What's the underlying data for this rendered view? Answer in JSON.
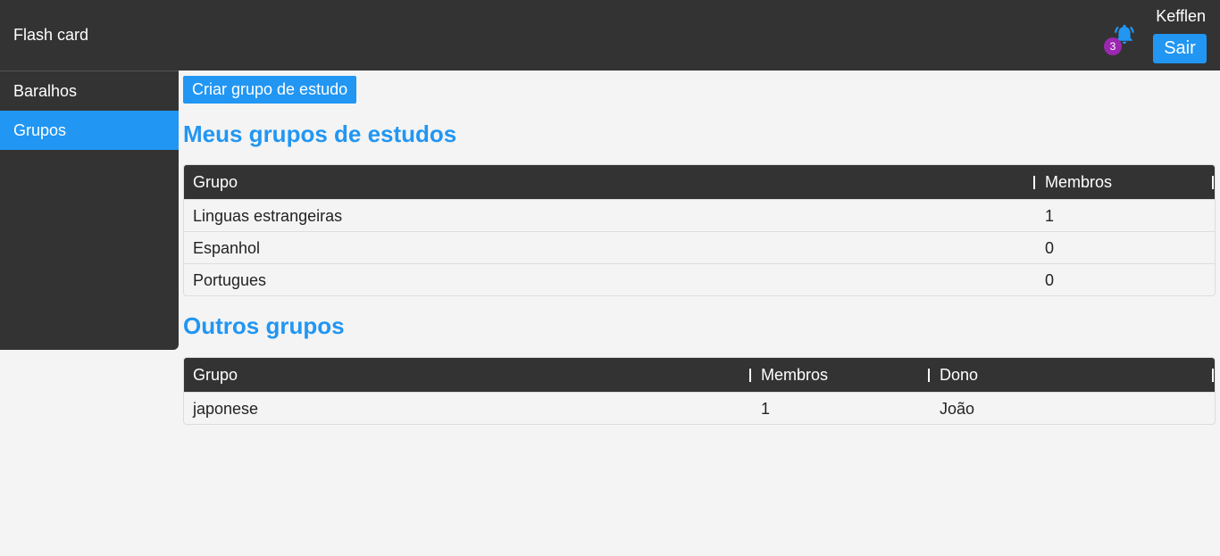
{
  "header": {
    "app_title": "Flash card",
    "username": "Kefflen",
    "logout_label": "Sair",
    "notification_count": "3",
    "bell_color": "#2196f3"
  },
  "sidebar": {
    "items": [
      {
        "label": "Baralhos",
        "active": false
      },
      {
        "label": "Grupos",
        "active": true
      }
    ]
  },
  "main": {
    "create_button_label": "Criar grupo de estudo",
    "my_groups": {
      "title": "Meus grupos de estudos",
      "columns": [
        "Grupo",
        "Membros"
      ],
      "rows": [
        {
          "group": "Linguas estrangeiras",
          "members": "1"
        },
        {
          "group": "Espanhol",
          "members": "0"
        },
        {
          "group": "Portugues",
          "members": "0"
        }
      ]
    },
    "other_groups": {
      "title": "Outros grupos",
      "columns": [
        "Grupo",
        "Membros",
        "Dono"
      ],
      "rows": [
        {
          "group": "japonese",
          "members": "1",
          "owner": "João"
        }
      ]
    }
  },
  "colors": {
    "accent": "#2196f3",
    "dark": "#333333",
    "badge": "#9c27b0",
    "background": "#f4f4f4"
  }
}
